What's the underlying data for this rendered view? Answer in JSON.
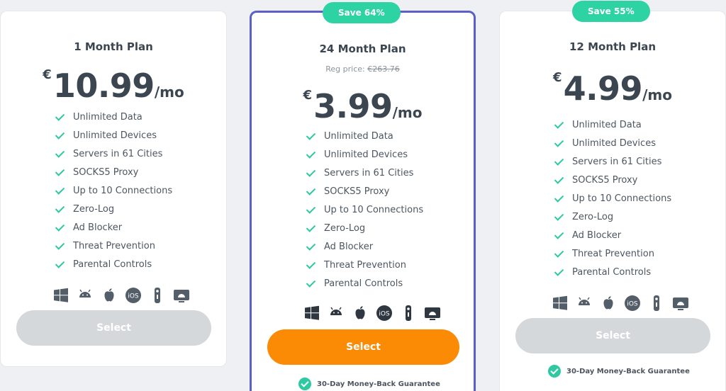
{
  "plans": [
    {
      "title": "1 Month Plan",
      "currency": "€",
      "amount": "10.99",
      "period": "/mo",
      "select_label": "Select",
      "features": [
        "Unlimited Data",
        "Unlimited Devices",
        "Servers in 61 Cities",
        "SOCKS5 Proxy",
        "Up to 10 Connections",
        "Zero-Log",
        "Ad Blocker",
        "Threat Prevention",
        "Parental Controls"
      ]
    },
    {
      "badge": "Save 64%",
      "title": "24 Month Plan",
      "reg_label": "Reg price:",
      "reg_price": "€263.76",
      "currency": "€",
      "amount": "3.99",
      "period": "/mo",
      "select_label": "Select",
      "guarantee": "30-Day Money-Back Guarantee",
      "features": [
        "Unlimited Data",
        "Unlimited Devices",
        "Servers in 61 Cities",
        "SOCKS5 Proxy",
        "Up to 10 Connections",
        "Zero-Log",
        "Ad Blocker",
        "Threat Prevention",
        "Parental Controls"
      ]
    },
    {
      "badge": "Save 55%",
      "title": "12 Month Plan",
      "currency": "€",
      "amount": "4.99",
      "period": "/mo",
      "select_label": "Select",
      "guarantee": "30-Day Money-Back Guarantee",
      "features": [
        "Unlimited Data",
        "Unlimited Devices",
        "Servers in 61 Cities",
        "SOCKS5 Proxy",
        "Up to 10 Connections",
        "Zero-Log",
        "Ad Blocker",
        "Threat Prevention",
        "Parental Controls"
      ]
    }
  ],
  "platform_icons": [
    "windows-icon",
    "android-icon",
    "apple-icon",
    "ios-icon",
    "firestick-icon",
    "android-tv-icon"
  ],
  "colors": {
    "accent_green": "#2ed3a3",
    "highlight_border": "#5b5fc7",
    "primary_button": "#fb8a05",
    "disabled_button": "#d5d8db"
  }
}
